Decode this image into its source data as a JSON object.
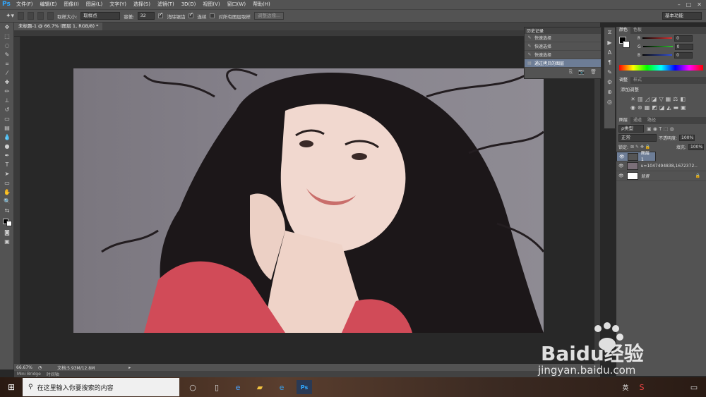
{
  "app": {
    "logo": "Ps"
  },
  "menu": [
    "文件(F)",
    "编辑(E)",
    "图像(I)",
    "图层(L)",
    "文字(Y)",
    "选择(S)",
    "滤镜(T)",
    "3D(D)",
    "视图(V)",
    "窗口(W)",
    "帮助(H)"
  ],
  "options": {
    "sample_size_label": "取样大小:",
    "sample_size_value": "取样点",
    "tolerance_label": "容差:",
    "tolerance_value": "32",
    "antialias_label": "消除锯齿",
    "contiguous_label": "连续",
    "sample_all_label": "对所有图层取样",
    "refine_edge_label": "调整边缘...",
    "workspace": "基本功能"
  },
  "document": {
    "tab_title": "未标题-1 @ 66.7% (图层 1, RGB/8) *",
    "zoom": "66.67%",
    "doc_size": "文档:5.93M/12.8M",
    "bottom_tabs": [
      "Mini Bridge",
      "时间轴"
    ]
  },
  "history": {
    "title": "历史记录",
    "items": [
      {
        "label": "快速选择",
        "active": false
      },
      {
        "label": "快速选择",
        "active": false
      },
      {
        "label": "快速选择",
        "active": false
      },
      {
        "label": "通过拷贝的图层",
        "active": true
      }
    ]
  },
  "color_panel": {
    "tabs": [
      "颜色",
      "色板"
    ],
    "channels": [
      {
        "name": "R",
        "value": "0",
        "color": "#e03030"
      },
      {
        "name": "G",
        "value": "0",
        "color": "#30c030"
      },
      {
        "name": "B",
        "value": "0",
        "color": "#3050e0"
      }
    ]
  },
  "adjustments": {
    "tabs": [
      "调整",
      "样式"
    ],
    "title": "添加调整"
  },
  "layers": {
    "tabs": [
      "图层",
      "通道",
      "路径"
    ],
    "filter_label": "ρ类型",
    "blend_mode": "正常",
    "opacity_label": "不透明度:",
    "opacity_value": "100%",
    "lock_label": "锁定:",
    "fill_label": "填充:",
    "fill_value": "100%",
    "items": [
      {
        "name": "图层 1",
        "selected": true
      },
      {
        "name": "u=1047494838,1672372...",
        "selected": false
      },
      {
        "name": "背景",
        "selected": false
      }
    ]
  },
  "taskbar": {
    "search_placeholder": "在这里输入你要搜索的内容",
    "ime": "英"
  },
  "watermark": {
    "brand": "Baidu经验",
    "url": "jingyan.baidu.com"
  }
}
